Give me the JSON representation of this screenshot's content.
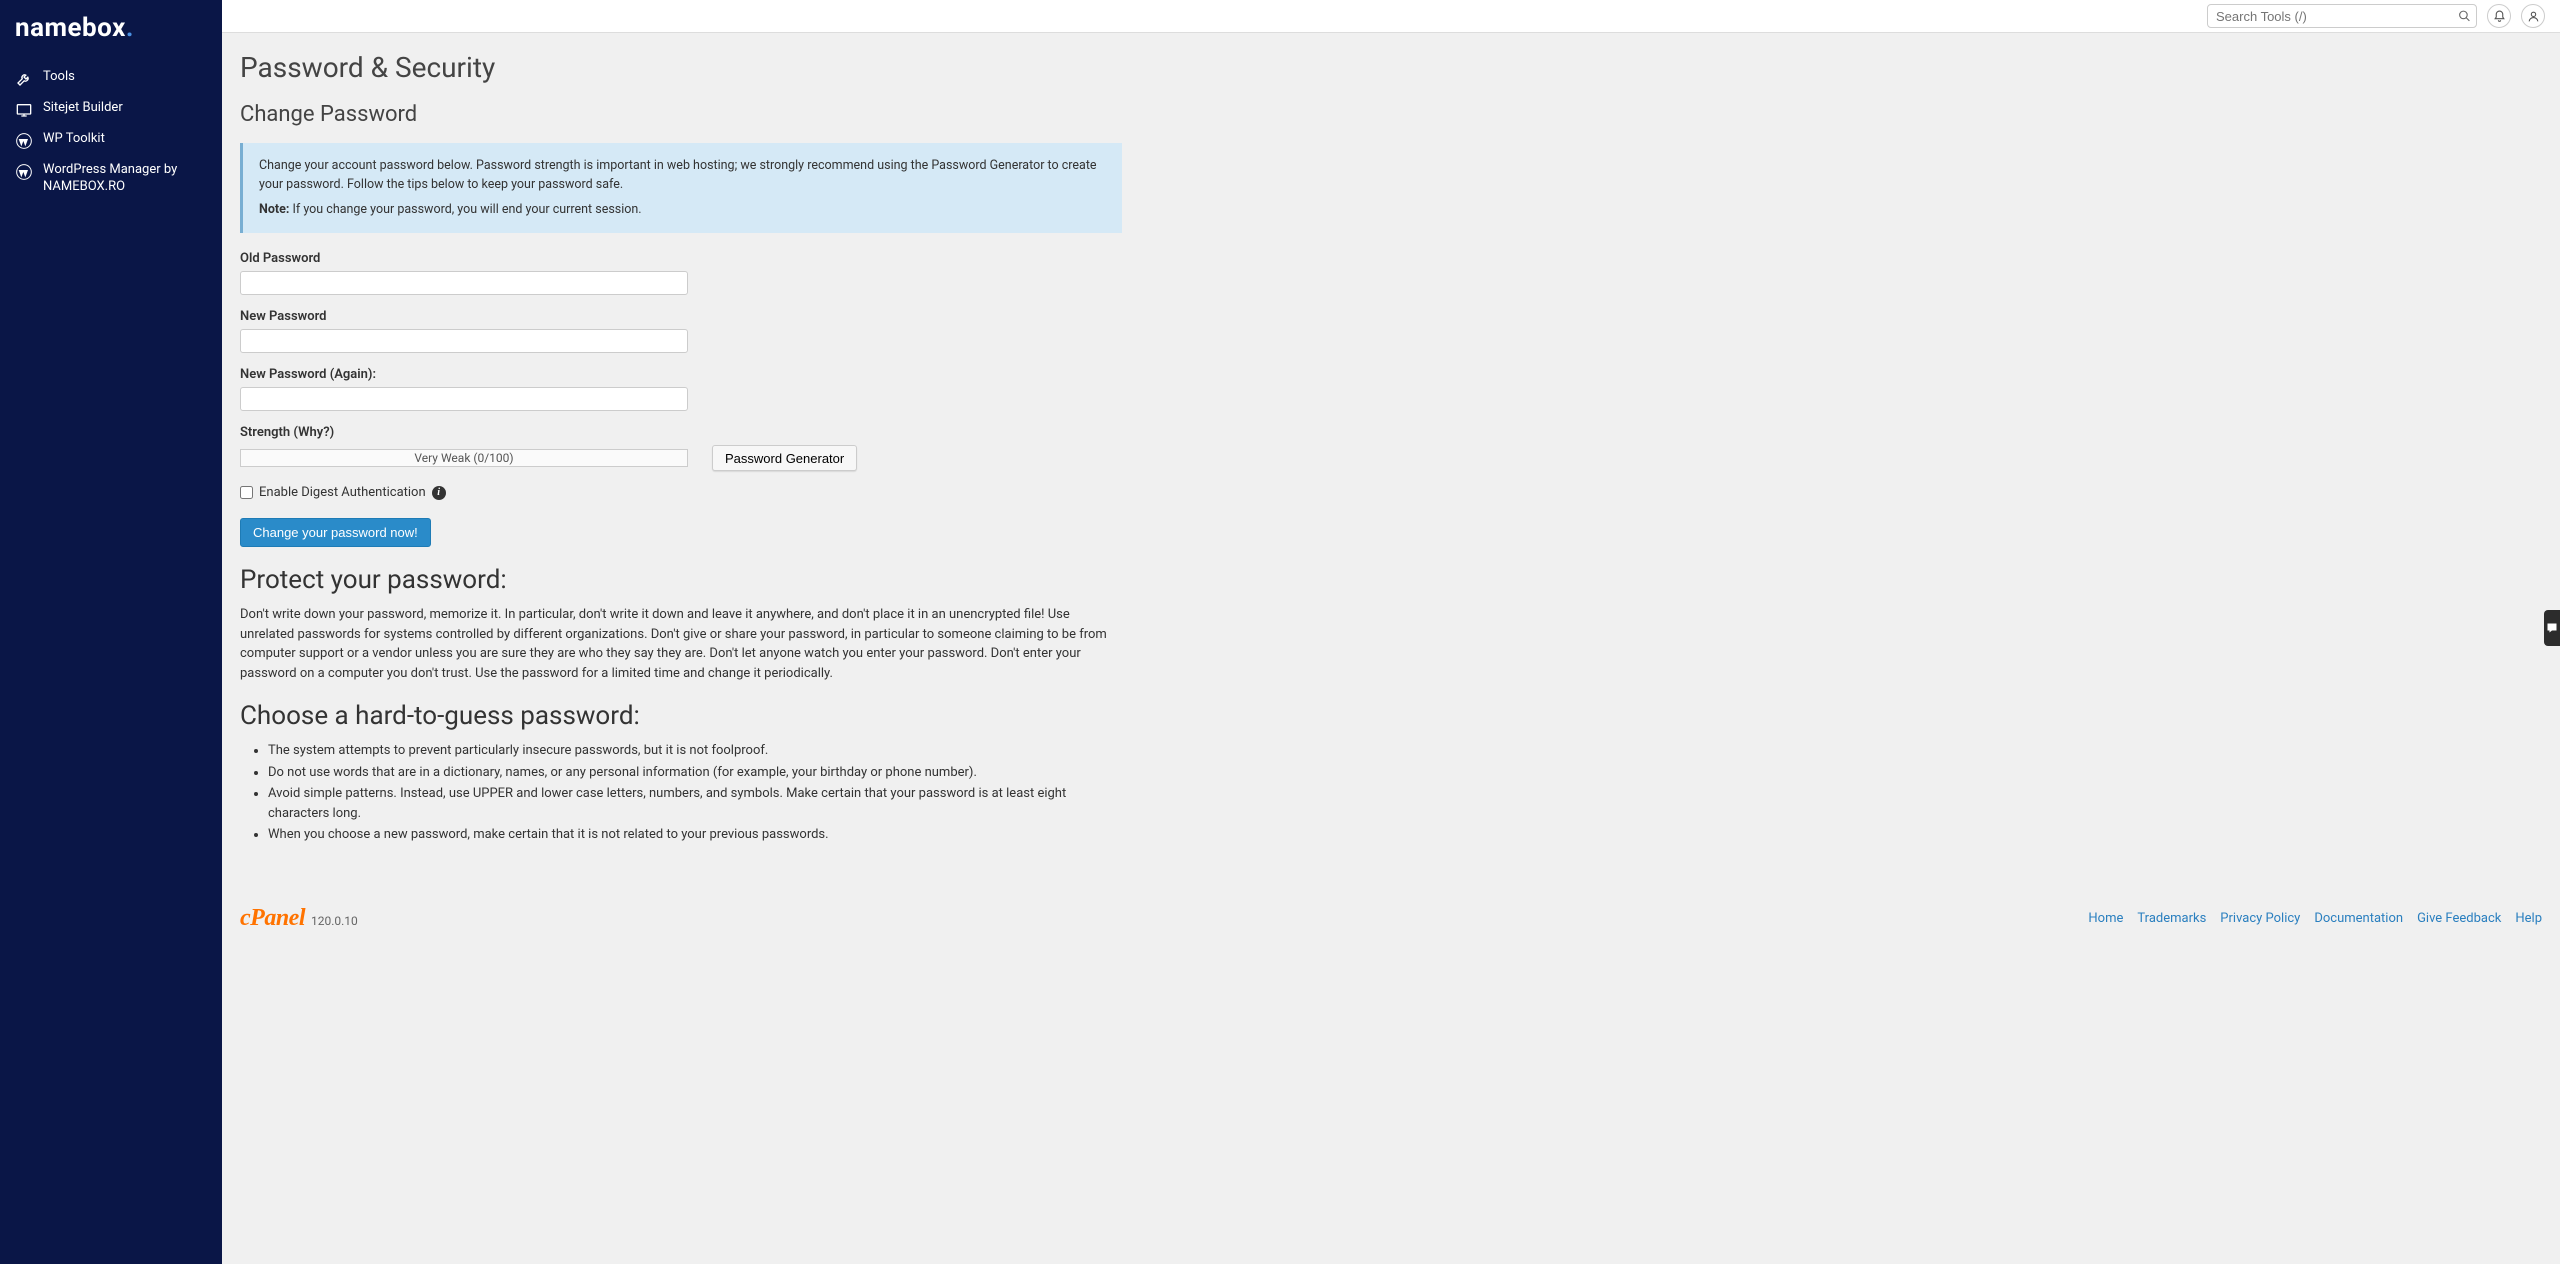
{
  "brand": {
    "name": "namebox",
    "dotColor": "#4a90e2"
  },
  "sidebar": {
    "items": [
      {
        "label": "Tools",
        "icon": "tools"
      },
      {
        "label": "Sitejet Builder",
        "icon": "sitejet"
      },
      {
        "label": "WP Toolkit",
        "icon": "wordpress"
      },
      {
        "label": "WordPress Manager by NAMEBOX.RO",
        "icon": "wordpress"
      }
    ]
  },
  "topbar": {
    "search_placeholder": "Search Tools (/)"
  },
  "page": {
    "title": "Password & Security",
    "change_title": "Change Password",
    "info1": "Change your account password below. Password strength is important in web hosting; we strongly recommend using the Password Generator to create your password. Follow the tips below to keep your password safe.",
    "info2_note": "Note:",
    "info2_rest": " If you change your password, you will end your current session.",
    "labels": {
      "old": "Old Password",
      "new": "New Password",
      "again": "New Password (Again):",
      "strength": "Strength (Why?)"
    },
    "strength_text": "Very Weak (0/100)",
    "pw_gen": "Password Generator",
    "digest": "Enable Digest Authentication",
    "submit": "Change your password now!",
    "protect_title": "Protect your password:",
    "protect_body": "Don't write down your password, memorize it. In particular, don't write it down and leave it anywhere, and don't place it in an unencrypted file! Use unrelated passwords for systems controlled by different organizations. Don't give or share your password, in particular to someone claiming to be from computer support or a vendor unless you are sure they are who they say they are. Don't let anyone watch you enter your password. Don't enter your password on a computer you don't trust. Use the password for a limited time and change it periodically.",
    "choose_title": "Choose a hard-to-guess password:",
    "tips": [
      "The system attempts to prevent particularly insecure passwords, but it is not foolproof.",
      "Do not use words that are in a dictionary, names, or any personal information (for example, your birthday or phone number).",
      "Avoid simple patterns. Instead, use UPPER and lower case letters, numbers, and symbols. Make certain that your password is at least eight characters long.",
      "When you choose a new password, make certain that it is not related to your previous passwords."
    ]
  },
  "footer": {
    "brand": "cPanel",
    "version": "120.0.10",
    "links": [
      "Home",
      "Trademarks",
      "Privacy Policy",
      "Documentation",
      "Give Feedback",
      "Help"
    ]
  }
}
